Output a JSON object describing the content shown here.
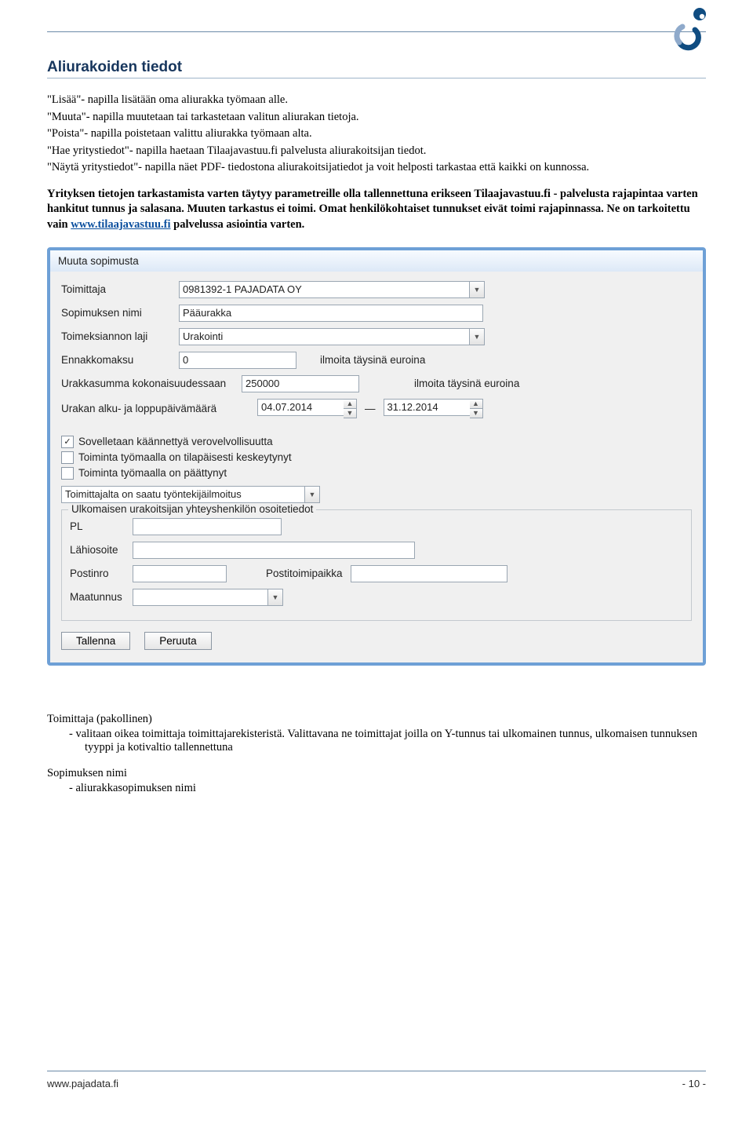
{
  "header": {
    "section_title": "Aliurakoiden tiedot"
  },
  "doc": {
    "p1": "\"Lisää\"- napilla lisätään oma aliurakka työmaan alle.",
    "p2": "\"Muuta\"- napilla muutetaan tai tarkastetaan valitun aliurakan tietoja.",
    "p3": "\"Poista\"- napilla poistetaan valittu aliurakka työmaan alta.",
    "p4": "\"Hae yritystiedot\"- napilla haetaan Tilaajavastuu.fi palvelusta aliurakoitsijan tiedot.",
    "p5": "\"Näytä yritystiedot\"- napilla näet PDF- tiedostona aliurakoitsijatiedot ja voit helposti tarkastaa että kaikki on kunnossa.",
    "bold1": "Yrityksen tietojen tarkastamista varten täytyy parametreille olla tallennettuna erikseen Tilaajavastuu.fi - palvelusta rajapintaa varten hankitut tunnus ja salasana. Muuten tarkastus ei toimi. Omat henkilökohtaiset tunnukset eivät toimi rajapinnassa. Ne on tarkoitettu vain ",
    "bold_link_text": "www.tilaajavastuu.fi",
    "bold2": " palvelussa asiointia varten."
  },
  "dialog": {
    "title": "Muuta sopimusta",
    "labels": {
      "toimittaja": "Toimittaja",
      "sopimuksen_nimi": "Sopimuksen nimi",
      "toimeksiannon_laji": "Toimeksiannon laji",
      "ennakkomaksu": "Ennakkomaksu",
      "ennakko_hint": "ilmoita täysinä euroina",
      "urakkasumma": "Urakkasumma kokonaisuudessaan",
      "urakkasumma_hint": "ilmoita täysinä euroina",
      "urakka_paivamaarat": "Urakan alku- ja loppupäivämäärä",
      "dash": "—",
      "chk1": "Sovelletaan käännettyä verovelvollisuutta",
      "chk2": "Toiminta työmaalla on tilapäisesti keskeytynyt",
      "chk3": "Toiminta työmaalla on päättynyt",
      "ilmoitus": "Toimittajalta on saatu työntekijäilmoitus",
      "group_legend": "Ulkomaisen urakoitsijan yhteyshenkilön osoitetiedot",
      "pl": "PL",
      "lahiosoite": "Lähiosoite",
      "postinro": "Postinro",
      "postitoimipaikka": "Postitoimipaikka",
      "maatunnus": "Maatunnus"
    },
    "values": {
      "toimittaja": "0981392-1 PAJADATA OY",
      "sopimuksen_nimi": "Pääurakka",
      "toimeksiannon_laji": "Urakointi",
      "ennakkomaksu": "0",
      "urakkasumma": "250000",
      "alku_paiva": "04.07.2014",
      "loppu_paiva": "31.12.2014",
      "chk1": true,
      "chk2": false,
      "chk3": false,
      "ilmoitus": "",
      "pl": "",
      "lahiosoite": "",
      "postinro": "",
      "postitoimipaikka": "",
      "maatunnus": ""
    },
    "buttons": {
      "save": "Tallenna",
      "cancel": "Peruuta"
    }
  },
  "footer_doc": {
    "toimittaja_label": "Toimittaja (pakollinen)",
    "toimittaja_text": "-   valitaan oikea toimittaja toimittajarekisteristä. Valittavana ne toimittajat joilla on Y-tunnus tai ulkomainen tunnus, ulkomaisen tunnuksen tyyppi ja kotivaltio tallennettuna",
    "sopimus_label": "Sopimuksen nimi",
    "sopimus_text": "-   aliurakkasopimuksen nimi"
  },
  "page_footer": {
    "url": "www.pajadata.fi",
    "page": "- 10 -"
  }
}
